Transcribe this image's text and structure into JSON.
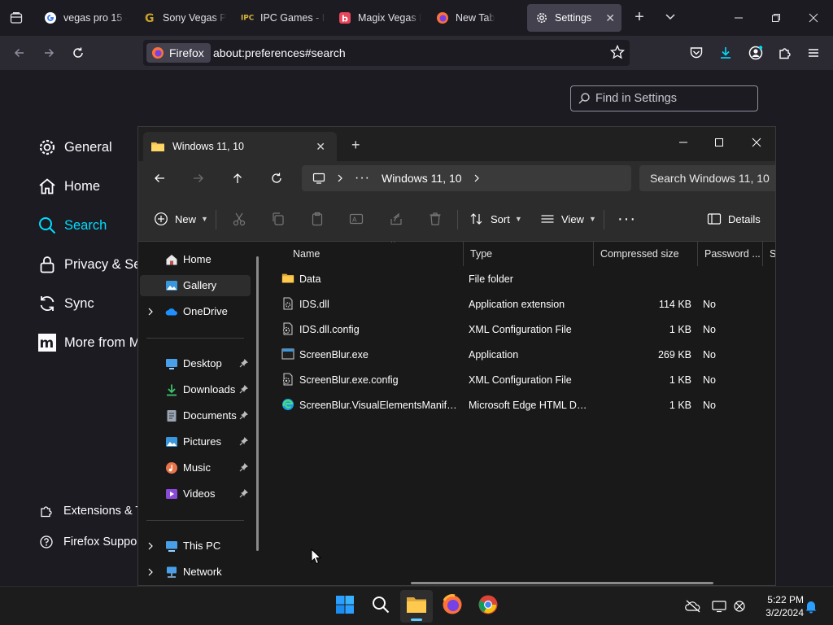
{
  "firefox": {
    "tabs": [
      {
        "title": "vegas pro 15 -",
        "favicon": "google-icon"
      },
      {
        "title": "Sony Vegas Pr",
        "favicon": "softonic-icon"
      },
      {
        "title": "IPC Games - IF",
        "favicon": "ipc-icon"
      },
      {
        "title": "Magix Vegas P",
        "favicon": "bandlab-icon"
      },
      {
        "title": "New Tab",
        "favicon": "firefox-icon"
      },
      {
        "title": "Settings",
        "favicon": "gear-icon",
        "active": true
      }
    ],
    "identity_label": "Firefox",
    "url": "about:preferences#search"
  },
  "settings": {
    "search_placeholder": "Find in Settings",
    "categories": [
      {
        "label": "General",
        "icon": "gear-icon"
      },
      {
        "label": "Home",
        "icon": "home-icon"
      },
      {
        "label": "Search",
        "icon": "search-icon",
        "selected": true
      },
      {
        "label": "Privacy & Se",
        "icon": "lock-icon"
      },
      {
        "label": "Sync",
        "icon": "sync-icon"
      },
      {
        "label": "More from M",
        "icon": "mozilla-icon"
      }
    ],
    "footer_links": [
      {
        "label": "Extensions & T",
        "icon": "puzzle-icon"
      },
      {
        "label": "Firefox Support",
        "icon": "help-icon"
      }
    ]
  },
  "explorer": {
    "tab_title": "Windows 11, 10",
    "path": {
      "current": "Windows 11, 10"
    },
    "search_placeholder": "Search Windows 11, 10",
    "commands": {
      "new": "New",
      "sort": "Sort",
      "view": "View",
      "details": "Details"
    },
    "nav": {
      "top": [
        {
          "label": "Home",
          "icon": "home-icon"
        },
        {
          "label": "Gallery",
          "icon": "gallery-icon",
          "selected": true
        },
        {
          "label": "OneDrive",
          "icon": "onedrive-icon",
          "expandable": true
        }
      ],
      "pinned": [
        {
          "label": "Desktop",
          "icon": "desktop-icon"
        },
        {
          "label": "Downloads",
          "icon": "download-icon"
        },
        {
          "label": "Documents",
          "icon": "document-icon"
        },
        {
          "label": "Pictures",
          "icon": "pictures-icon"
        },
        {
          "label": "Music",
          "icon": "music-icon"
        },
        {
          "label": "Videos",
          "icon": "videos-icon"
        }
      ],
      "bottom": [
        {
          "label": "This PC",
          "icon": "pc-icon"
        },
        {
          "label": "Network",
          "icon": "network-icon"
        }
      ]
    },
    "columns": [
      "Name",
      "Type",
      "Compressed size",
      "Password ...",
      "Si"
    ],
    "files": [
      {
        "name": "Data",
        "type": "File folder",
        "size": "",
        "password": "",
        "icon": "folder-icon"
      },
      {
        "name": "IDS.dll",
        "type": "Application extension",
        "size": "114 KB",
        "password": "No",
        "icon": "dll-icon"
      },
      {
        "name": "IDS.dll.config",
        "type": "XML Configuration File",
        "size": "1 KB",
        "password": "No",
        "icon": "config-file-icon"
      },
      {
        "name": "ScreenBlur.exe",
        "type": "Application",
        "size": "269 KB",
        "password": "No",
        "icon": "exe-icon"
      },
      {
        "name": "ScreenBlur.exe.config",
        "type": "XML Configuration File",
        "size": "1 KB",
        "password": "No",
        "icon": "config-file-icon"
      },
      {
        "name": "ScreenBlur.VisualElementsManifest.xml",
        "type": "Microsoft Edge HTML Document",
        "size": "1 KB",
        "password": "No",
        "icon": "edge-icon"
      }
    ]
  },
  "taskbar": {
    "time": "5:22 PM",
    "date": "3/2/2024",
    "accent": "#60cdff"
  }
}
